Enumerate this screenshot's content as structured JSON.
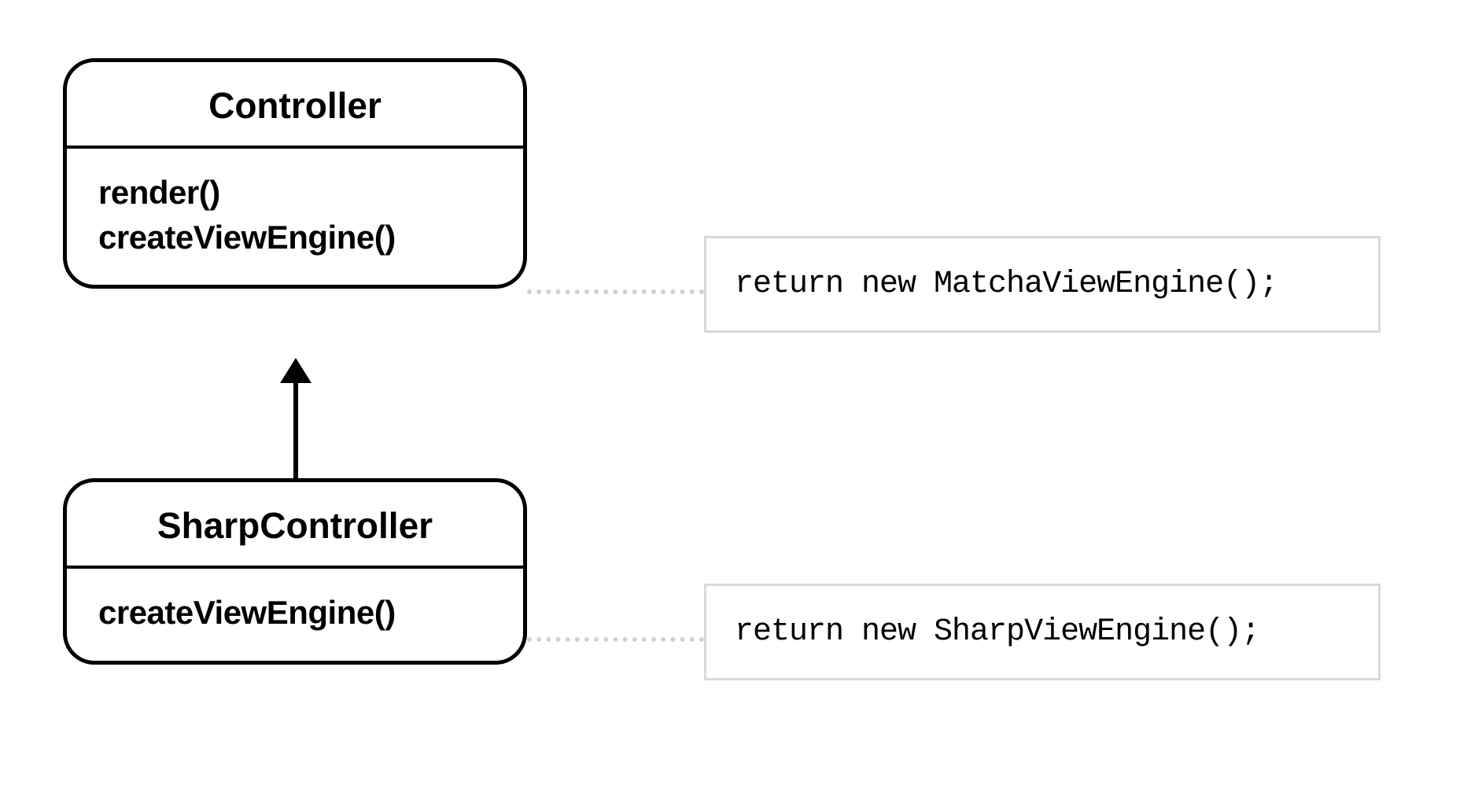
{
  "classes": {
    "controller": {
      "name": "Controller",
      "methods": [
        "render()",
        "createViewEngine()"
      ]
    },
    "sharpController": {
      "name": "SharpController",
      "methods": [
        "createViewEngine()"
      ]
    }
  },
  "notes": {
    "controllerNote": "return new MatchaViewEngine();",
    "sharpNote": "return new SharpViewEngine();"
  }
}
